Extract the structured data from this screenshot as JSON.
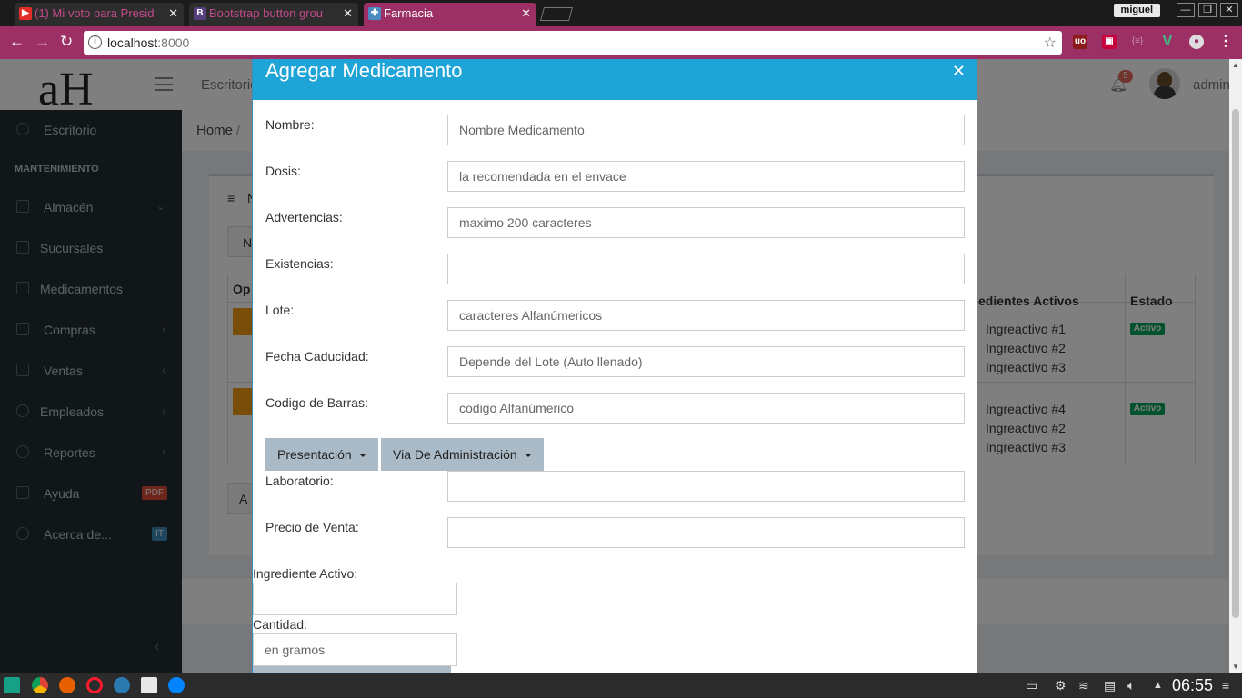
{
  "browser": {
    "tabs": [
      {
        "title": "(1) Mi voto para Presid",
        "favicon": "youtube-icon",
        "color": "#e52d27"
      },
      {
        "title": "Bootstrap button grou",
        "favicon": "bootstrap-icon",
        "color": "#563d7c"
      },
      {
        "title": "Farmacia",
        "favicon": "farmacia-icon",
        "color": "#4a8bc2"
      }
    ],
    "user": "miguel",
    "url_host": "localhost",
    "url_port": ":8000"
  },
  "header": {
    "logo_text": "aH",
    "link": "Escritorio",
    "notifications": "5",
    "user": "admin"
  },
  "sidebar": {
    "section_header": "MANTENIMIENTO",
    "items": [
      {
        "label": "Escritorio"
      },
      {
        "label": "Almacén"
      },
      {
        "label": "Sucursales"
      },
      {
        "label": "Medicamentos"
      },
      {
        "label": "Compras"
      },
      {
        "label": "Ventas"
      },
      {
        "label": "Empleados"
      },
      {
        "label": "Reportes"
      },
      {
        "label": "Ayuda",
        "tag": "PDF",
        "tag_color": "#dd4b39"
      },
      {
        "label": "Acerca de...",
        "tag": "IT",
        "tag_color": "#3c8dbc"
      }
    ]
  },
  "breadcrumb": {
    "home": "Home",
    "sep": "/"
  },
  "background_table": {
    "col_ingredientes": "edientes Activos",
    "col_estado": "Estado",
    "col_op": "Op",
    "rows": [
      {
        "ingredientes": [
          "Ingreactivo #1",
          "Ingreactivo #2",
          "Ingreactivo #3"
        ],
        "estado": "Activo"
      },
      {
        "ingredientes": [
          "Ingreactivo #4",
          "Ingreactivo #2",
          "Ingreactivo #3"
        ],
        "estado": "Activo"
      }
    ],
    "box_title_initial": "N",
    "button_initial": "N",
    "bottom_button_initial": "A"
  },
  "modal": {
    "title": "Agregar Medicamento",
    "fields": [
      {
        "label": "Nombre:",
        "placeholder": "Nombre Medicamento"
      },
      {
        "label": "Dosis:",
        "placeholder": "la recomendada en el envace"
      },
      {
        "label": "Advertencias:",
        "placeholder": "maximo 200 caracteres"
      },
      {
        "label": "Existencias:",
        "placeholder": ""
      },
      {
        "label": "Lote:",
        "placeholder": "caracteres Alfanúmericos"
      },
      {
        "label": "Fecha Caducidad:",
        "placeholder": "Depende del Lote (Auto llenado)"
      },
      {
        "label": "Codigo de Barras:",
        "placeholder": "codigo Alfanúmerico"
      }
    ],
    "dropdown_presentacion": "Presentación",
    "dropdown_via": "Via De Administración",
    "fields_after": [
      {
        "label": "Laboratorio:",
        "placeholder": ""
      },
      {
        "label": "Precio de Venta:",
        "placeholder": ""
      }
    ],
    "ingrediente_label": "Ingrediente Activo:",
    "ingrediente_placeholder": "",
    "cantidad_label": "Cantidad:",
    "cantidad_placeholder": "en gramos"
  },
  "taskbar": {
    "clock": "06:55"
  }
}
